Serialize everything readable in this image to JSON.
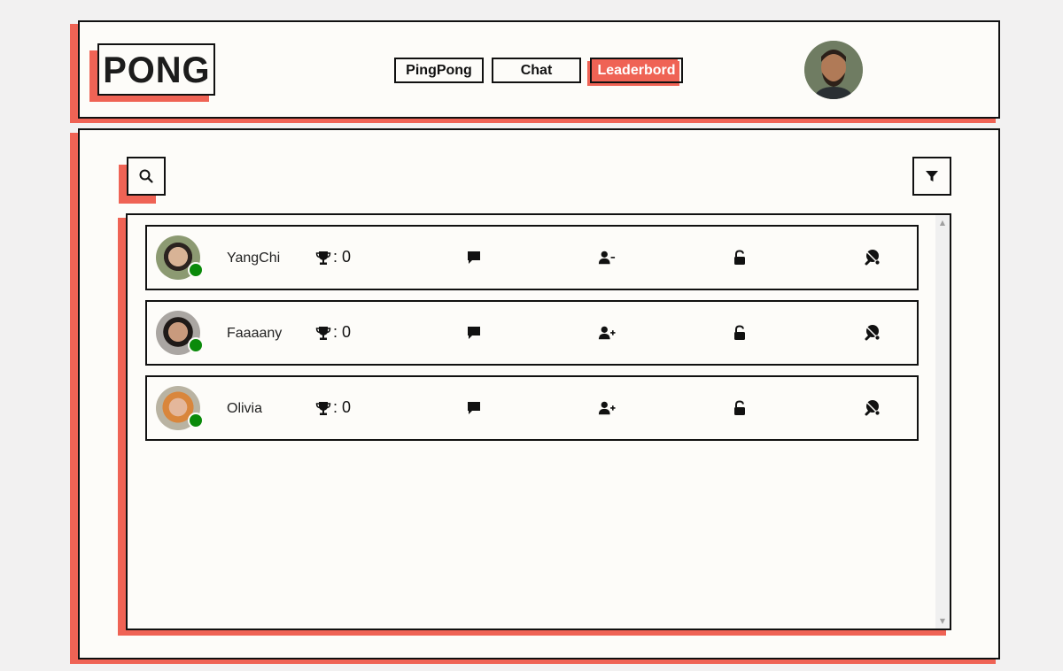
{
  "app": {
    "logo_text": "PONG"
  },
  "nav": {
    "items": [
      {
        "label": "PingPong",
        "active": false
      },
      {
        "label": "Chat",
        "active": false
      },
      {
        "label": "Leaderbord",
        "active": true
      }
    ]
  },
  "colors": {
    "accent": "#ef6355",
    "background": "#fdfcf9",
    "page": "#f2f1f1",
    "border": "#111111",
    "online": "#0a8a0a"
  },
  "toolbar": {
    "search_icon": "search-icon",
    "filter_icon": "filter-icon"
  },
  "players": [
    {
      "name": "YangChi",
      "trophies": ": 0",
      "status": "online",
      "friend_action": "remove-friend-icon"
    },
    {
      "name": "Faaaany",
      "trophies": ": 0",
      "status": "online",
      "friend_action": "add-friend-icon"
    },
    {
      "name": "Olivia",
      "trophies": ": 0",
      "status": "online",
      "friend_action": "add-friend-icon"
    }
  ]
}
